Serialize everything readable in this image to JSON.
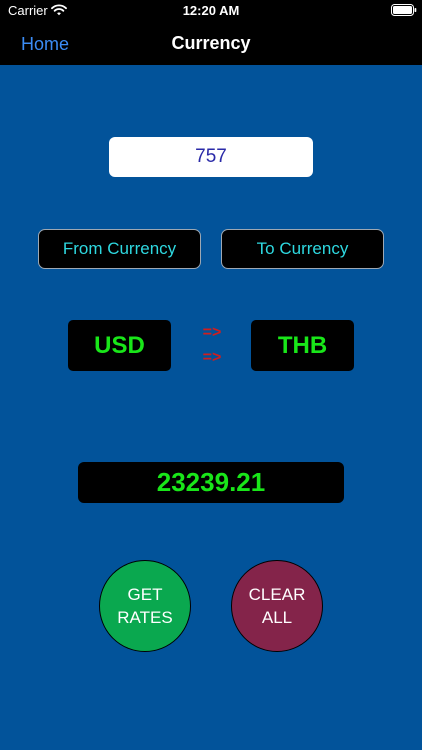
{
  "status_bar": {
    "carrier": "Carrier",
    "time": "12:20 AM"
  },
  "nav": {
    "back_label": "Home",
    "title": "Currency"
  },
  "amount_input": {
    "value": "757"
  },
  "buttons": {
    "from_currency": "From Currency",
    "to_currency": "To Currency",
    "get_rates_line1": "GET",
    "get_rates_line2": "RATES",
    "clear_all_line1": "CLEAR",
    "clear_all_line2": "ALL"
  },
  "conversion": {
    "from_code": "USD",
    "to_code": "THB",
    "arrow": "=>",
    "result": "23239.21"
  },
  "colors": {
    "background": "#02539a",
    "nav_bar": "#000000",
    "link": "#3b8cf5",
    "button_text": "#2ed8e0",
    "code_text": "#19e619",
    "arrow": "#d11e1e",
    "get_rates": "#0aa84f",
    "clear_all": "#84244a"
  },
  "icons": {
    "wifi": "wifi-icon",
    "battery": "battery-icon"
  }
}
